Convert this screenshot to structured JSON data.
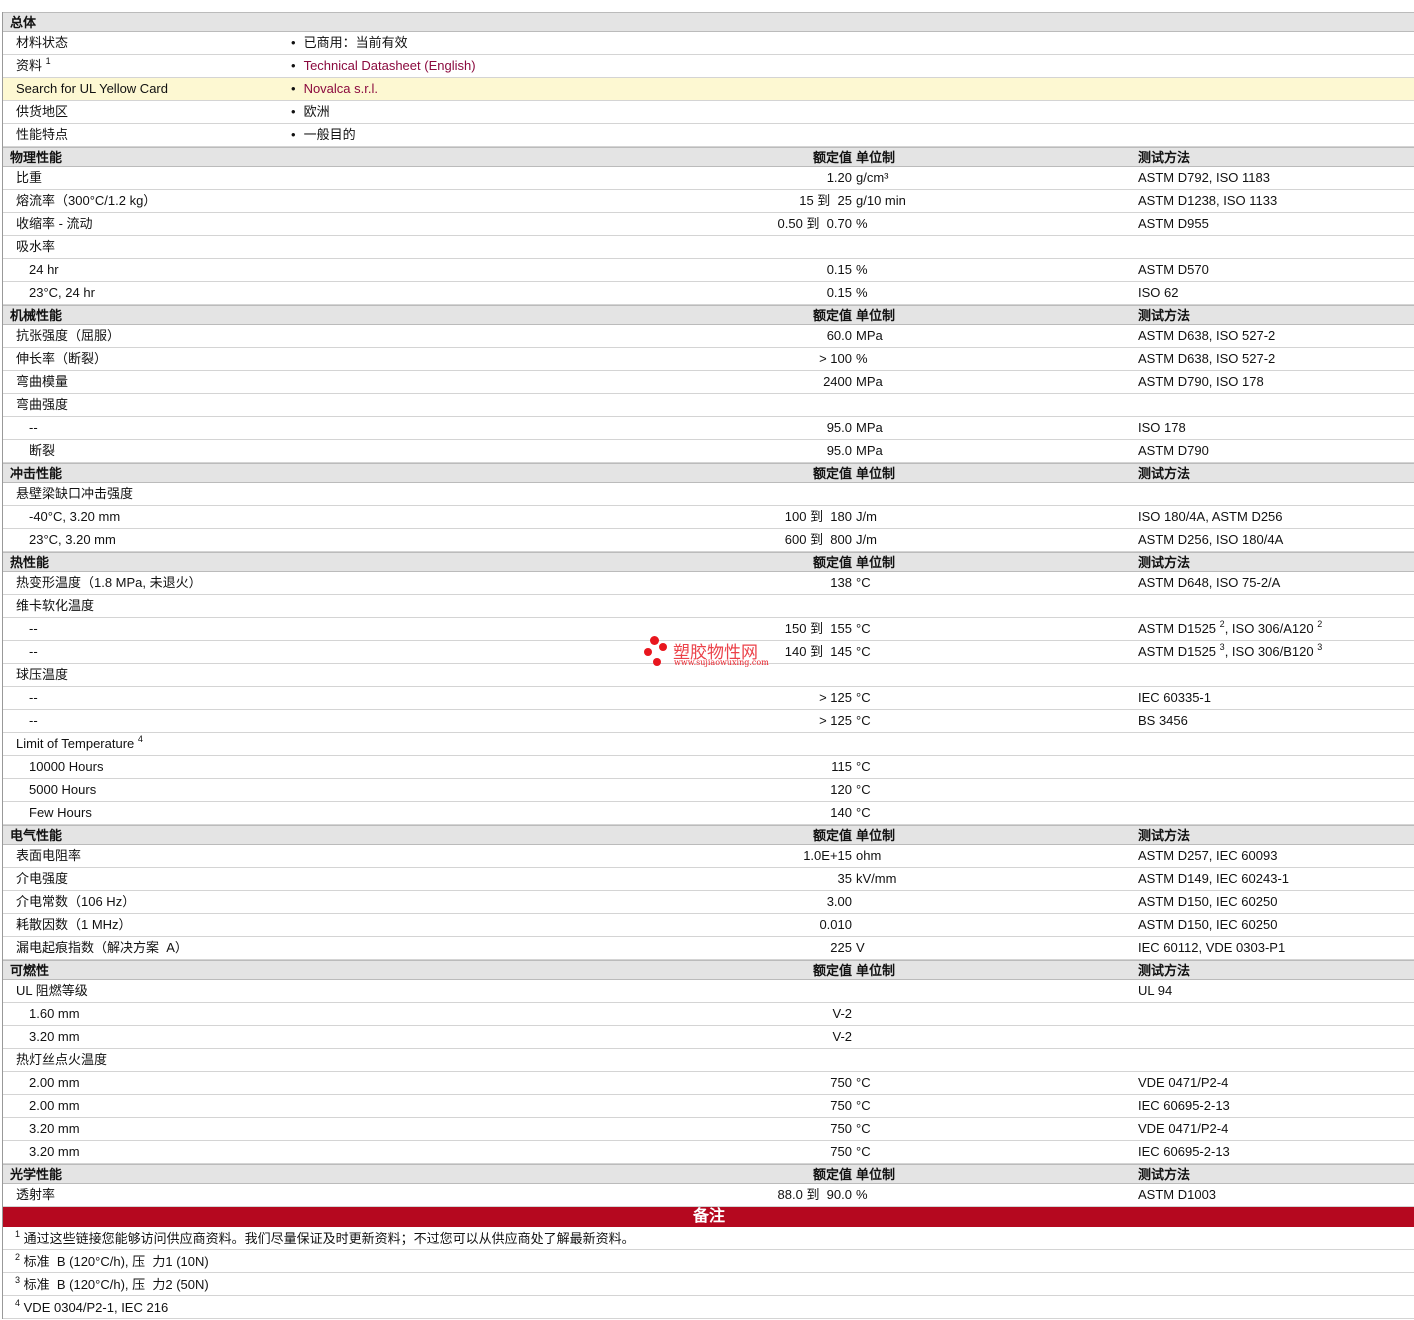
{
  "general": {
    "title": "总体",
    "rows": [
      {
        "label": "材料状态",
        "value": "已商用：当前有效"
      },
      {
        "label": "资料",
        "sup": "1",
        "value": "Technical Datasheet (English)",
        "link": true
      },
      {
        "label": "Search for UL Yellow Card",
        "value": "Novalca s.r.l.",
        "link": true,
        "highlight": true
      },
      {
        "label": "供货地区",
        "value": "欧洲"
      },
      {
        "label": "性能特点",
        "value": "一般目的"
      }
    ]
  },
  "col_headers": {
    "value": "额定值",
    "unit": "单位制",
    "method": "测试方法"
  },
  "sections": [
    {
      "title": "物理性能",
      "rows": [
        {
          "label": "比重",
          "value": "1.20",
          "unit": "g/cm³",
          "method": "ASTM D792, ISO 1183"
        },
        {
          "label": "熔流率（300°C/1.2 kg）",
          "value": "15 到  25",
          "unit": "g/10 min",
          "method": "ASTM D1238, ISO 1133"
        },
        {
          "label": "收缩率 - 流动",
          "value": "0.50 到  0.70",
          "unit": "%",
          "method": "ASTM D955"
        },
        {
          "label": "吸水率"
        },
        {
          "label": "24 hr",
          "indent": true,
          "value": "0.15",
          "unit": "%",
          "method": "ASTM D570"
        },
        {
          "label": "23°C, 24 hr",
          "indent": true,
          "value": "0.15",
          "unit": "%",
          "method": "ISO 62"
        }
      ]
    },
    {
      "title": "机械性能",
      "rows": [
        {
          "label": "抗张强度（屈服）",
          "value": "60.0",
          "unit": "MPa",
          "method": "ASTM D638, ISO 527-2"
        },
        {
          "label": "伸长率（断裂）",
          "value": "> 100",
          "unit": "%",
          "method": "ASTM D638, ISO 527-2"
        },
        {
          "label": "弯曲模量",
          "value": "2400",
          "unit": "MPa",
          "method": "ASTM D790, ISO 178"
        },
        {
          "label": "弯曲强度"
        },
        {
          "label": "--",
          "indent": true,
          "value": "95.0",
          "unit": "MPa",
          "method": "ISO 178"
        },
        {
          "label": "断裂",
          "indent": true,
          "value": "95.0",
          "unit": "MPa",
          "method": "ASTM D790"
        }
      ]
    },
    {
      "title": "冲击性能",
      "rows": [
        {
          "label": "悬壁梁缺口冲击强度"
        },
        {
          "label": "-40°C, 3.20 mm",
          "indent": true,
          "value": "100 到  180",
          "unit": "J/m",
          "method": "ISO 180/4A, ASTM D256"
        },
        {
          "label": "23°C, 3.20 mm",
          "indent": true,
          "value": "600 到  800",
          "unit": "J/m",
          "method": "ASTM D256, ISO 180/4A"
        }
      ]
    },
    {
      "title": "热性能",
      "rows": [
        {
          "label": "热变形温度（1.8 MPa, 未退火）",
          "value": "138",
          "unit": "°C",
          "method": "ASTM D648, ISO 75-2/A"
        },
        {
          "label": "维卡软化温度"
        },
        {
          "label": "--",
          "indent": true,
          "value": "150 到  155",
          "unit": "°C",
          "method": "ASTM D1525",
          "msup": "2",
          "method2": ", ISO 306/A120",
          "msup2": "2"
        },
        {
          "label": "--",
          "indent": true,
          "value": "140 到  145",
          "unit": "°C",
          "method": "ASTM D1525",
          "msup": "3",
          "method2": ", ISO 306/B120",
          "msup2": "3"
        },
        {
          "label": "球压温度"
        },
        {
          "label": "--",
          "indent": true,
          "value": "> 125",
          "unit": "°C",
          "method": "IEC 60335-1"
        },
        {
          "label": "--",
          "indent": true,
          "value": "> 125",
          "unit": "°C",
          "method": "BS 3456"
        },
        {
          "label": "Limit of Temperature",
          "sup": "4"
        },
        {
          "label": "10000 Hours",
          "indent": true,
          "value": "115",
          "unit": "°C"
        },
        {
          "label": "5000 Hours",
          "indent": true,
          "value": "120",
          "unit": "°C"
        },
        {
          "label": "Few Hours",
          "indent": true,
          "value": "140",
          "unit": "°C"
        }
      ]
    },
    {
      "title": "电气性能",
      "rows": [
        {
          "label": "表面电阻率",
          "value": "1.0E+15",
          "unit": "ohm",
          "method": "ASTM D257, IEC 60093"
        },
        {
          "label": "介电强度",
          "value": "35",
          "unit": "kV/mm",
          "method": "ASTM D149, IEC 60243-1"
        },
        {
          "label": "介电常数（106 Hz）",
          "value": "3.00",
          "method": "ASTM D150, IEC 60250"
        },
        {
          "label": "耗散因数（1 MHz）",
          "value": "0.010",
          "method": "ASTM D150, IEC 60250"
        },
        {
          "label": "漏电起痕指数（解决方案  A）",
          "value": "225",
          "unit": "V",
          "method": "IEC 60112, VDE 0303-P1"
        }
      ]
    },
    {
      "title": "可燃性",
      "rows": [
        {
          "label": "UL 阻燃等级",
          "method": "UL 94"
        },
        {
          "label": "1.60 mm",
          "indent": true,
          "value": "V-2"
        },
        {
          "label": "3.20 mm",
          "indent": true,
          "value": "V-2"
        },
        {
          "label": "热灯丝点火温度"
        },
        {
          "label": "2.00 mm",
          "indent": true,
          "value": "750",
          "unit": "°C",
          "method": "VDE 0471/P2-4"
        },
        {
          "label": "2.00 mm",
          "indent": true,
          "value": "750",
          "unit": "°C",
          "method": "IEC 60695-2-13"
        },
        {
          "label": "3.20 mm",
          "indent": true,
          "value": "750",
          "unit": "°C",
          "method": "VDE 0471/P2-4"
        },
        {
          "label": "3.20 mm",
          "indent": true,
          "value": "750",
          "unit": "°C",
          "method": "IEC 60695-2-13"
        }
      ]
    },
    {
      "title": "光学性能",
      "rows": [
        {
          "label": "透射率",
          "value": "88.0 到  90.0",
          "unit": "%",
          "method": "ASTM D1003"
        }
      ]
    }
  ],
  "notes": {
    "title": "备注",
    "items": [
      {
        "num": "1",
        "text": "通过这些链接您能够访问供应商资料。我们尽量保证及时更新资料；不过您可以从供应商处了解最新资料。"
      },
      {
        "num": "2",
        "text": "标准  B (120°C/h), 压  力1 (10N)"
      },
      {
        "num": "3",
        "text": "标准  B (120°C/h), 压  力2 (50N)"
      },
      {
        "num": "4",
        "text": "VDE 0304/P2-1, IEC 216"
      }
    ]
  },
  "watermark": {
    "text": "塑胶物性网",
    "url": "www.sujiaowuxing.com"
  }
}
